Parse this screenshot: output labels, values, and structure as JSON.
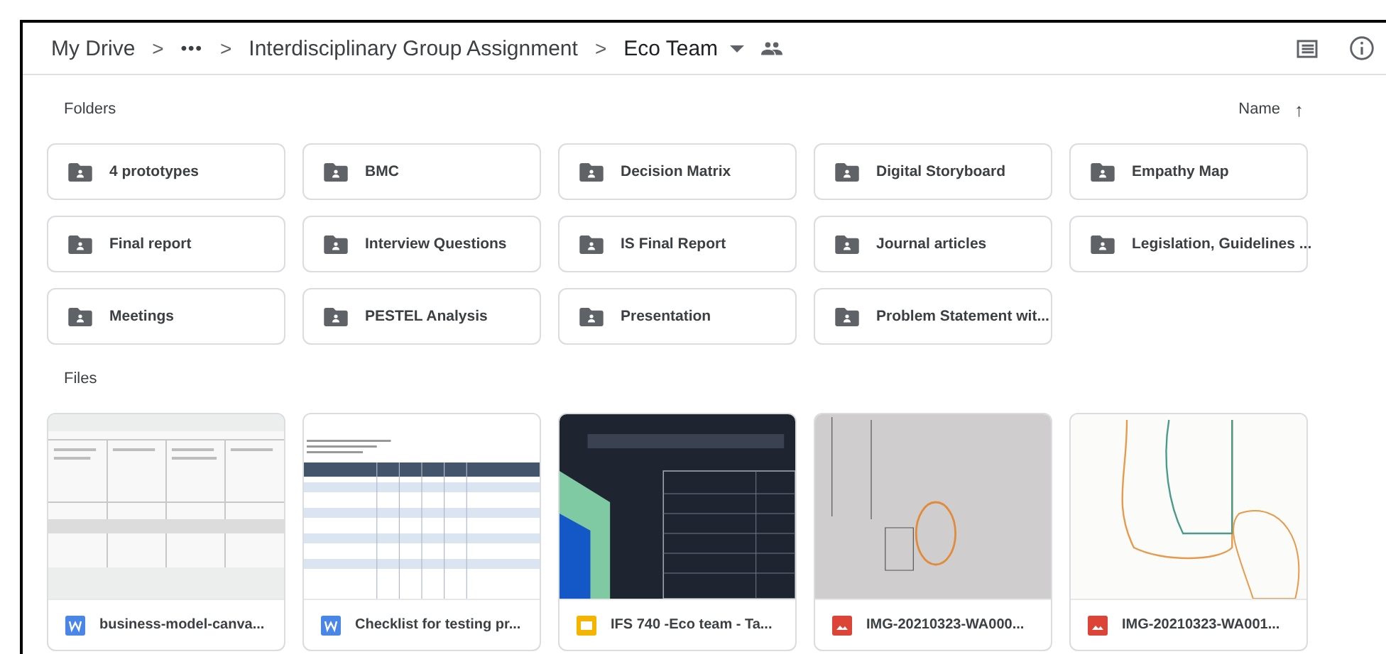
{
  "breadcrumb": {
    "items": [
      {
        "label": "My Drive",
        "kind": "link"
      },
      {
        "label": "•••",
        "kind": "more"
      },
      {
        "label": "Interdisciplinary Group Assignment",
        "kind": "link"
      },
      {
        "label": "Eco Team",
        "kind": "current"
      }
    ],
    "separator": ">"
  },
  "folders": {
    "heading": "Folders",
    "sort": {
      "label": "Name",
      "arrow": "↑"
    },
    "items": [
      {
        "name": "4 prototypes"
      },
      {
        "name": "BMC"
      },
      {
        "name": "Decision Matrix"
      },
      {
        "name": "Digital Storyboard"
      },
      {
        "name": "Empathy Map"
      },
      {
        "name": "Final report"
      },
      {
        "name": "Interview Questions"
      },
      {
        "name": "IS Final Report"
      },
      {
        "name": "Journal articles"
      },
      {
        "name": "Legislation, Guidelines ..."
      },
      {
        "name": "Meetings"
      },
      {
        "name": "PESTEL Analysis"
      },
      {
        "name": "Presentation"
      },
      {
        "name": "Problem Statement wit..."
      }
    ]
  },
  "files": {
    "heading": "Files",
    "items": [
      {
        "name": "business-model-canva...",
        "kind": "doc",
        "thumbnail": {
          "kind": "doc"
        }
      },
      {
        "name": "Checklist for testing pr...",
        "kind": "doc",
        "thumbnail": {
          "kind": "table"
        }
      },
      {
        "name": "IFS 740 -Eco team - Ta...",
        "kind": "slides",
        "thumbnail": {
          "kind": "slide"
        }
      },
      {
        "name": "IMG-20210323-WA000...",
        "kind": "image",
        "thumbnail": {
          "kind": "photo"
        }
      },
      {
        "name": "IMG-20210323-WA001...",
        "kind": "image",
        "thumbnail": {
          "kind": "sketch"
        }
      }
    ]
  }
}
